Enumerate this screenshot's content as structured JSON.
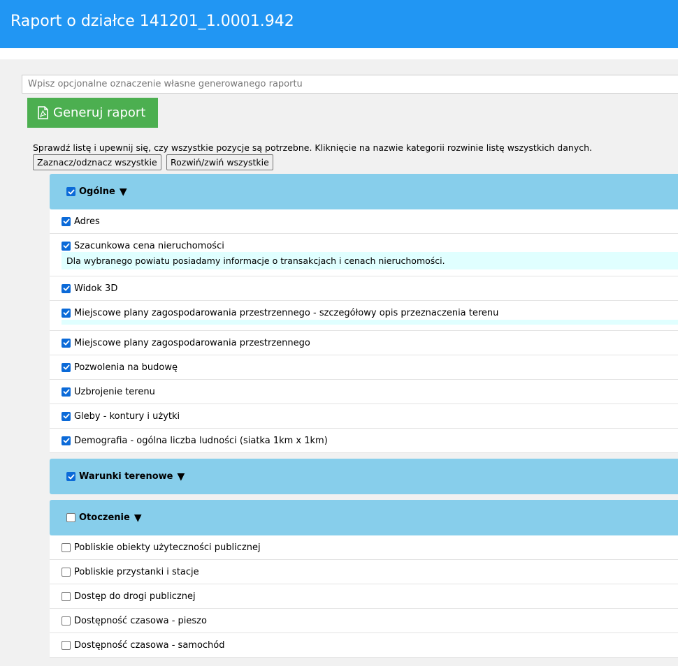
{
  "header": {
    "title": "Raport o działce 141201_1.0001.942"
  },
  "report": {
    "name_placeholder": "Wpisz opcjonalne oznaczenie własne generowanego raportu",
    "generate_label": "Generuj raport"
  },
  "instructions": "Sprawdź listę i upewnij się, czy wszystkie pozycje są potrzebne. Kliknięcie na nazwie kategorii rozwinie listę wszystkich danych.",
  "buttons": {
    "toggle_all": "Zaznacz/odznacz wszystkie",
    "expand_all": "Rozwiń/zwiń wszystkie"
  },
  "arrow": "▼",
  "categories": [
    {
      "label": "Ogólne",
      "checked": true,
      "items": [
        {
          "label": "Adres",
          "checked": true
        },
        {
          "label": "Szacunkowa cena nieruchomości",
          "checked": true,
          "note": "Dla wybranego powiatu posiadamy informacje o transakcjach i cenach nieruchomości."
        },
        {
          "label": "Widok 3D",
          "checked": true
        },
        {
          "label": "Miejscowe plany zagospodarowania przestrzennego - szczegółowy opis przeznaczenia terenu",
          "checked": true
        },
        {
          "label": "Miejscowe plany zagospodarowania przestrzennego",
          "checked": true
        },
        {
          "label": "Pozwolenia na budowę",
          "checked": true
        },
        {
          "label": "Uzbrojenie terenu",
          "checked": true
        },
        {
          "label": "Gleby - kontury i użytki",
          "checked": true
        },
        {
          "label": "Demografia - ogólna liczba ludności (siatka 1km x 1km)",
          "checked": true
        }
      ]
    },
    {
      "label": "Warunki terenowe",
      "checked": true,
      "items": []
    },
    {
      "label": "Otoczenie",
      "checked": false,
      "items": [
        {
          "label": "Pobliskie obiekty użyteczności publicznej",
          "checked": false
        },
        {
          "label": "Pobliskie przystanki i stacje",
          "checked": false
        },
        {
          "label": "Dostęp do drogi publicznej",
          "checked": false
        },
        {
          "label": "Dostępność czasowa - pieszo",
          "checked": false
        },
        {
          "label": "Dostępność czasowa - samochód",
          "checked": false
        }
      ]
    }
  ],
  "colors": {
    "header_bg": "#2196f3",
    "generate_bg": "#4caf50",
    "category_bg": "#87ceeb",
    "note_bg": "#e0ffff",
    "checkbox_on": "#0b6ad8"
  }
}
